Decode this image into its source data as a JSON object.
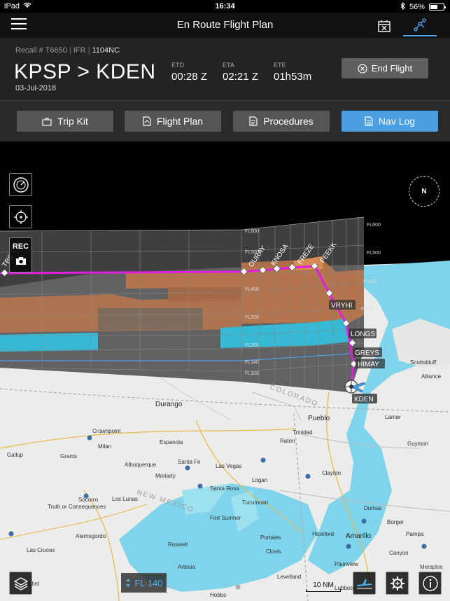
{
  "status": {
    "device": "iPad",
    "time": "16:34",
    "battery": "56%",
    "battery_level": 0.56
  },
  "nav": {
    "title": "En Route Flight Plan"
  },
  "header": {
    "recall_prefix": "Recall # T6650",
    "flight_rules": "IFR",
    "tail": "1104NC",
    "route": "KPSP > KDEN",
    "date": "03-Jul-2018",
    "etd_label": "ETD",
    "etd": "00:28 Z",
    "eta_label": "ETA",
    "eta": "02:21 Z",
    "ete_label": "ETE",
    "ete": "01h53m",
    "end_flight": "End Flight"
  },
  "tabs": [
    {
      "label": "Trip Kit",
      "icon": "briefcase-icon"
    },
    {
      "label": "Flight Plan",
      "icon": "document-icon"
    },
    {
      "label": "Procedures",
      "icon": "clipboard-icon"
    },
    {
      "label": "Nav Log",
      "icon": "list-icon",
      "active": true
    }
  ],
  "side_controls": {
    "rec": "REC",
    "compass": "N"
  },
  "flight_levels": [
    "FL600",
    "FL500",
    "FL400",
    "FL300",
    "FL200",
    "FL140",
    "FL100"
  ],
  "waypoints": [
    "TBC",
    "OURAY",
    "KNOSA",
    "FREZE",
    "PEEKK",
    "VRYHI",
    "LONGS",
    "GREYS",
    "HIMAY",
    "KDEN"
  ],
  "map_labels": {
    "states": [
      "COLORADO",
      "NEW MEXICO"
    ],
    "cities": [
      "Durango",
      "Pueblo",
      "Santa Fe",
      "Albuquerque",
      "Las Vegas",
      "Amarillo",
      "Roswell",
      "Clovis",
      "Tucumcari",
      "Las Cruces",
      "Alamogordo",
      "Hobbs",
      "Lubbock",
      "Dumas",
      "Borger",
      "Pampa",
      "Hereford",
      "Plainview",
      "Levelland",
      "Portales",
      "Artesia",
      "Fort Sumner",
      "Moriarty",
      "Los Lunas",
      "Socorro",
      "Espanola",
      "Raton",
      "Lamar",
      "Trinidad",
      "Guymon",
      "Clayton",
      "Gallup",
      "Grants",
      "Milan",
      "Crownpoint",
      "Truth or Consequences",
      "Santa Rosa",
      "Logan",
      "Clint",
      "Memphis",
      "Canyon",
      "Scottsbluff",
      "Alliance"
    ]
  },
  "bottom": {
    "flight_level": "FL 140",
    "scale": "10 NM"
  }
}
